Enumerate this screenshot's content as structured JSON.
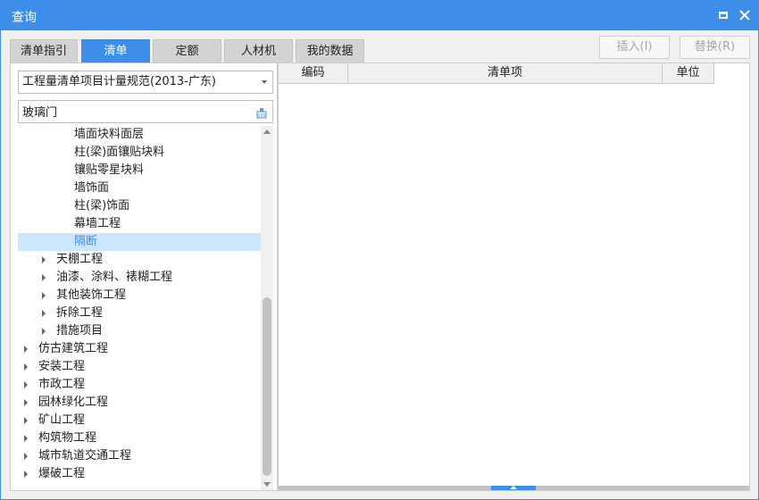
{
  "window": {
    "title": "查询"
  },
  "tabs": [
    {
      "label": "清单指引",
      "active": false
    },
    {
      "label": "清单",
      "active": true
    },
    {
      "label": "定额",
      "active": false
    },
    {
      "label": "人材机",
      "active": false
    },
    {
      "label": "我的数据",
      "active": false
    }
  ],
  "actions": {
    "insert_label": "插入(I)",
    "replace_label": "替换(R)"
  },
  "filter": {
    "spec_value": "工程量清单项目计量规范(2013-广东)",
    "search_value": "玻璃门"
  },
  "tree": [
    {
      "label": "墙面块料面层",
      "level": 3,
      "expandable": false,
      "selected": false
    },
    {
      "label": "柱(梁)面镶贴块料",
      "level": 3,
      "expandable": false,
      "selected": false
    },
    {
      "label": "镶贴零星块料",
      "level": 3,
      "expandable": false,
      "selected": false
    },
    {
      "label": "墙饰面",
      "level": 3,
      "expandable": false,
      "selected": false
    },
    {
      "label": "柱(梁)饰面",
      "level": 3,
      "expandable": false,
      "selected": false
    },
    {
      "label": "幕墙工程",
      "level": 3,
      "expandable": false,
      "selected": false
    },
    {
      "label": "隔断",
      "level": 3,
      "expandable": false,
      "selected": true
    },
    {
      "label": "天棚工程",
      "level": 2,
      "expandable": true,
      "selected": false
    },
    {
      "label": "油漆、涂料、裱糊工程",
      "level": 2,
      "expandable": true,
      "selected": false
    },
    {
      "label": "其他装饰工程",
      "level": 2,
      "expandable": true,
      "selected": false
    },
    {
      "label": "拆除工程",
      "level": 2,
      "expandable": true,
      "selected": false
    },
    {
      "label": "措施项目",
      "level": 2,
      "expandable": true,
      "selected": false
    },
    {
      "label": "仿古建筑工程",
      "level": 1,
      "expandable": true,
      "selected": false
    },
    {
      "label": "安装工程",
      "level": 1,
      "expandable": true,
      "selected": false
    },
    {
      "label": "市政工程",
      "level": 1,
      "expandable": true,
      "selected": false
    },
    {
      "label": "园林绿化工程",
      "level": 1,
      "expandable": true,
      "selected": false
    },
    {
      "label": "矿山工程",
      "level": 1,
      "expandable": true,
      "selected": false
    },
    {
      "label": "构筑物工程",
      "level": 1,
      "expandable": true,
      "selected": false
    },
    {
      "label": "城市轨道交通工程",
      "level": 1,
      "expandable": true,
      "selected": false
    },
    {
      "label": "爆破工程",
      "level": 1,
      "expandable": true,
      "selected": false
    }
  ],
  "grid": {
    "columns": [
      "编码",
      "清单项",
      "单位"
    ]
  },
  "colors": {
    "accent": "#3c8ee8",
    "selection_bg": "#cce6fb",
    "tab_inactive": "#d3d3d3",
    "disabled_text": "#a6a6a6"
  }
}
